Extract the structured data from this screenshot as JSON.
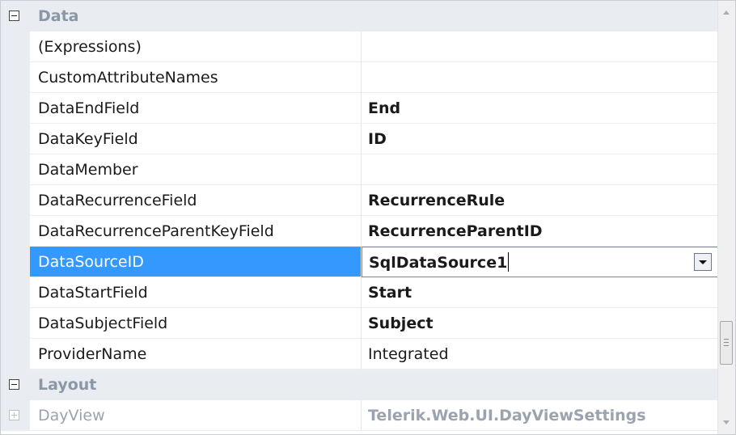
{
  "categories": {
    "data": {
      "label": "Data"
    },
    "layout": {
      "label": "Layout"
    }
  },
  "properties": [
    {
      "name": "(Expressions)",
      "value": ""
    },
    {
      "name": "CustomAttributeNames",
      "value": ""
    },
    {
      "name": "DataEndField",
      "value": "End"
    },
    {
      "name": "DataKeyField",
      "value": "ID"
    },
    {
      "name": "DataMember",
      "value": ""
    },
    {
      "name": "DataRecurrenceField",
      "value": "RecurrenceRule"
    },
    {
      "name": "DataRecurrenceParentKeyField",
      "value": "RecurrenceParentID"
    },
    {
      "name": "DataSourceID",
      "value": "SqlDataSource1"
    },
    {
      "name": "DataStartField",
      "value": "Start"
    },
    {
      "name": "DataSubjectField",
      "value": "Subject"
    },
    {
      "name": "ProviderName",
      "value": "Integrated"
    }
  ],
  "layout_properties": [
    {
      "name": "DayView",
      "value": "Telerik.Web.UI.DayViewSettings"
    }
  ],
  "icons": {
    "collapse": "minus-box-icon",
    "expand": "plus-box-icon",
    "dropdown": "chevron-down-icon"
  },
  "colors": {
    "selection": "#3399ff",
    "category_text": "#8b96a6",
    "gutter": "#e9ecf1"
  }
}
